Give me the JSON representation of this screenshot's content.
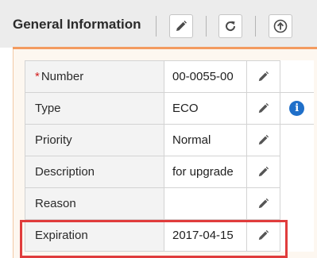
{
  "header": {
    "title": "General Information"
  },
  "toolbar": {
    "edit_icon": "pencil-icon",
    "refresh_icon": "refresh-icon",
    "upload_icon": "arrow-up-circle-icon"
  },
  "properties": {
    "rows": [
      {
        "label": "Number",
        "required": "*",
        "value": "00-0055-00"
      },
      {
        "label": "Type",
        "value": "ECO",
        "info_icon": "i"
      },
      {
        "label": "Priority",
        "value": "Normal"
      },
      {
        "label": "Description",
        "value": "for upgrade"
      },
      {
        "label": "Reason",
        "value": ""
      },
      {
        "label": "Expiration",
        "value": "2017-04-15"
      }
    ]
  },
  "colors": {
    "accent_orange": "#f39b60",
    "highlight_red": "#e03c3c",
    "info_blue": "#1f6fc9",
    "icon_gray": "#555555"
  }
}
